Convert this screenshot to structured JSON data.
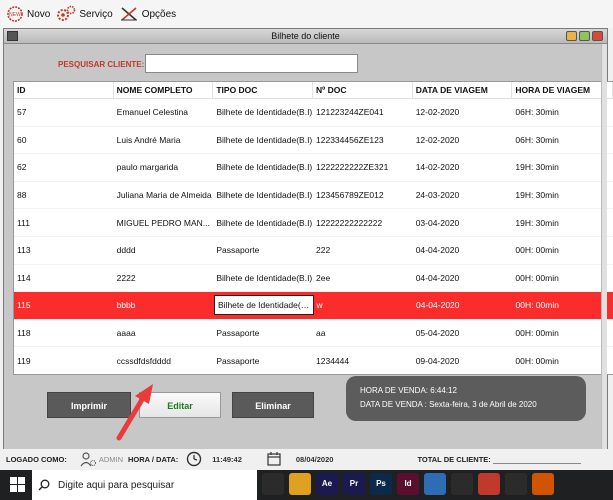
{
  "toolbar": {
    "items": [
      {
        "label": "Novo",
        "icon": "new-doc-icon"
      },
      {
        "label": "Serviço",
        "icon": "gears-icon"
      },
      {
        "label": "Opções",
        "icon": "cross-tools-icon"
      }
    ]
  },
  "window": {
    "title": "Bilhete do cliente"
  },
  "search": {
    "label": "PESQUISAR CLIENTE:",
    "value": "",
    "placeholder": ""
  },
  "table": {
    "columns": [
      "ID",
      "NOME COMPLETO",
      "TIPO DOC",
      "Nº DOC",
      "DATA DE VIAGEM",
      "HORA DE VIAGEM"
    ],
    "rows": [
      [
        "57",
        "Emanuel Celestina",
        "Bilhete de Identidade(B.I)",
        "121223244ZE041",
        "12-02-2020",
        "06H: 30min"
      ],
      [
        "60",
        "Luis André Maria",
        "Bilhete de Identidade(B.I)",
        "122334456ZE123",
        "12-02-2020",
        "06H: 30min"
      ],
      [
        "62",
        "paulo margarida",
        "Bilhete de Identidade(B.I)",
        "1222222222ZE321",
        "14-02-2020",
        "19H: 30min"
      ],
      [
        "88",
        "Juliana Maria de Almeida",
        "Bilhete de Identidade(B.I)",
        "123456789ZE012",
        "24-03-2020",
        "19H: 30min"
      ],
      [
        "111",
        "MIGUEL  PEDRO MAN...",
        "Bilhete de Identidade(B.I)",
        "12222222222222",
        "03-04-2020",
        "19H: 30min"
      ],
      [
        "113",
        "dddd",
        "Passaporte",
        "222",
        "04-04-2020",
        "00H: 00min"
      ],
      [
        "114",
        "2222",
        "Bilhete de Identidade(B.I)",
        "2ee",
        "04-04-2020",
        "00H: 00min"
      ],
      [
        "115",
        "bbbb",
        "Bilhete de Identidade(B.I)",
        "w",
        "04-04-2020",
        "00H: 00min"
      ],
      [
        "118",
        "aaaa",
        "Passaporte",
        "aa",
        "05-04-2020",
        "00H: 00min"
      ],
      [
        "119",
        "ccssdfdsfdddd",
        "Passaporte",
        "1234444",
        "09-04-2020",
        "00H: 00min"
      ]
    ],
    "selected_row_index": 7
  },
  "buttons": {
    "print": "Imprimir",
    "edit": "Editar",
    "delete": "Eliminar"
  },
  "sale": {
    "time_label": "HORA DE VENDA:",
    "time_value": "6:44:12",
    "date_label": "DATA DE VENDA :",
    "date_value": "Sexta-feira, 3 de Abril de 2020"
  },
  "status": {
    "logged_label": "LOGADO COMO:",
    "user": "ADMIN",
    "time_date_label": "HORA / DATA:",
    "time": "11:49:42",
    "date": "08/04/2020",
    "total_label": "TOTAL DE CLIENTE:"
  },
  "taskbar": {
    "search_placeholder": "Digite aqui para pesquisar",
    "apps": [
      {
        "name": "task-view-icon",
        "color": "#2b2b2b",
        "text": ""
      },
      {
        "name": "file-explorer-icon",
        "color": "#e0a020",
        "text": ""
      },
      {
        "name": "after-effects-icon",
        "color": "#1a1a50",
        "text": "Ae"
      },
      {
        "name": "premiere-icon",
        "color": "#1a1a50",
        "text": "Pr"
      },
      {
        "name": "photoshop-icon",
        "color": "#0b2a4a",
        "text": "Ps"
      },
      {
        "name": "indesign-icon",
        "color": "#5a0f2e",
        "text": "Id"
      },
      {
        "name": "netbeans-icon",
        "color": "#2d6db5",
        "text": ""
      },
      {
        "name": "chrome-icon",
        "color": "#2b2b2b",
        "text": ""
      },
      {
        "name": "opera-icon",
        "color": "#c0392b",
        "text": ""
      },
      {
        "name": "store-icon",
        "color": "#2b2b2b",
        "text": ""
      },
      {
        "name": "media-icon",
        "color": "#d35400",
        "text": ""
      }
    ]
  }
}
